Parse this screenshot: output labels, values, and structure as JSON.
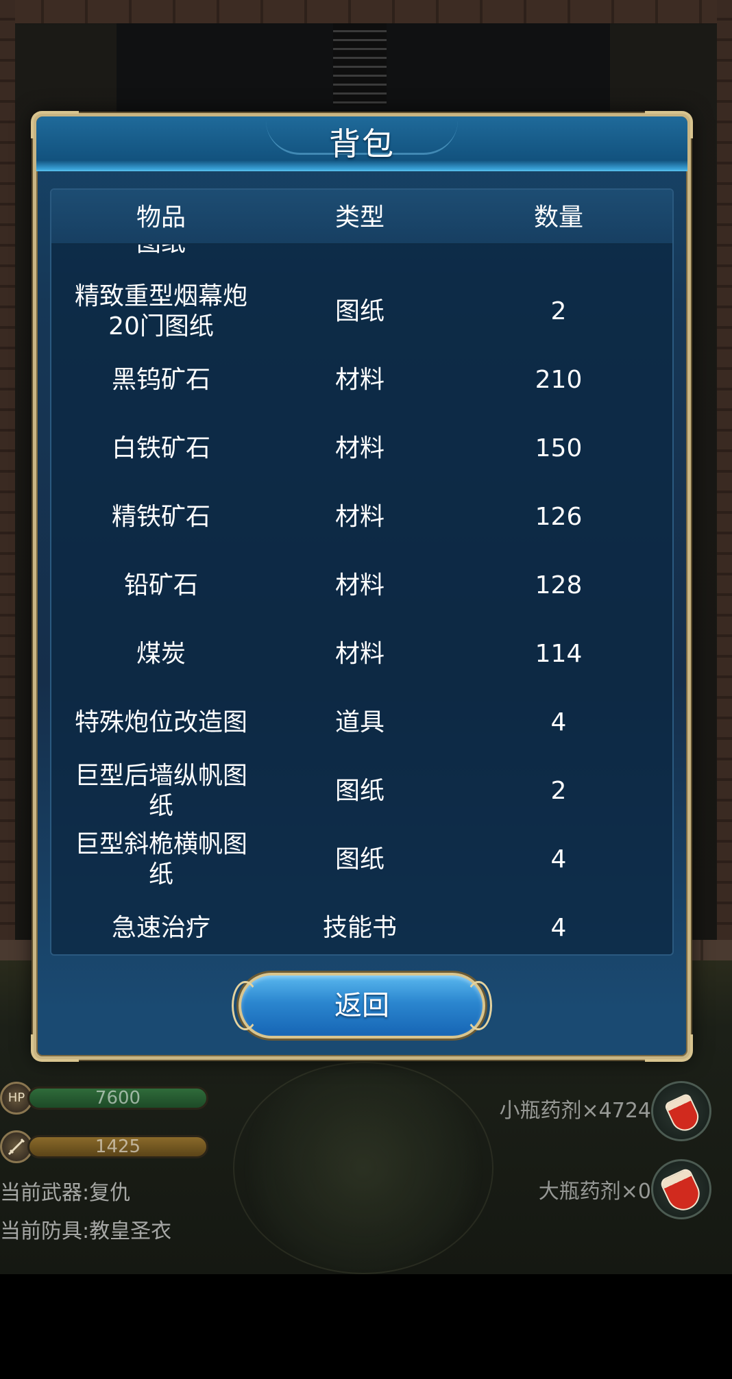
{
  "dialog": {
    "title": "背包",
    "headers": {
      "item": "物品",
      "type": "类型",
      "quantity": "数量"
    },
    "partial_row": {
      "item": "图纸",
      "type": "",
      "quantity": ""
    },
    "rows": [
      {
        "item": "精致重型烟幕炮\n20门图纸",
        "type": "图纸",
        "quantity": "2"
      },
      {
        "item": "黑钨矿石",
        "type": "材料",
        "quantity": "210"
      },
      {
        "item": "白铁矿石",
        "type": "材料",
        "quantity": "150"
      },
      {
        "item": "精铁矿石",
        "type": "材料",
        "quantity": "126"
      },
      {
        "item": "铅矿石",
        "type": "材料",
        "quantity": "128"
      },
      {
        "item": "煤炭",
        "type": "材料",
        "quantity": "114"
      },
      {
        "item": "特殊炮位改造图",
        "type": "道具",
        "quantity": "4"
      },
      {
        "item": "巨型后墙纵帆图\n纸",
        "type": "图纸",
        "quantity": "2"
      },
      {
        "item": "巨型斜桅横帆图\n纸",
        "type": "图纸",
        "quantity": "4"
      },
      {
        "item": "急速治疗",
        "type": "技能书",
        "quantity": "4"
      }
    ],
    "back_label": "返回"
  },
  "hud": {
    "hp_icon": "HP",
    "hp_value": "7600",
    "mp_value": "1425",
    "weapon": "当前武器:复仇",
    "armor": "当前防具:教皇圣衣",
    "small_potion": "小瓶药剂×4724",
    "large_potion": "大瓶药剂×0"
  },
  "colors": {
    "dialog_border": "#c9b583",
    "title_bar": "#1f6a9a",
    "back_button": "#2b86cf",
    "hp_bar": "#2f6b3a",
    "mp_bar": "#8a6a2a"
  },
  "icons": [
    "sword-icon",
    "potion-flask-icon"
  ]
}
